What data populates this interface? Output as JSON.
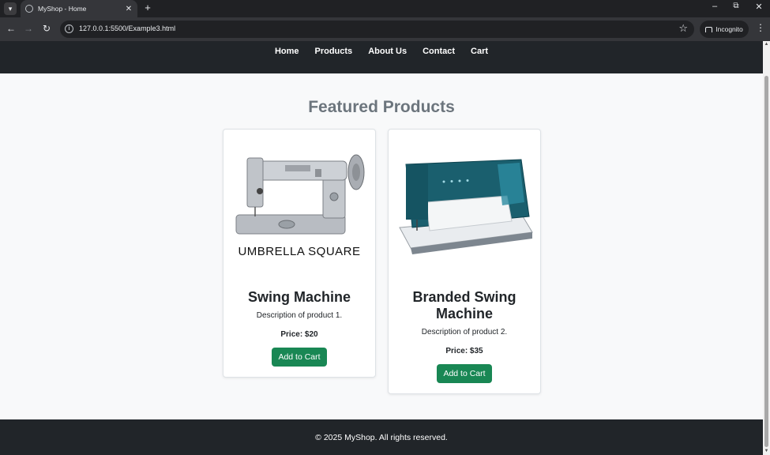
{
  "browser": {
    "tab_title": "MyShop - Home",
    "url": "127.0.0.1:5500/Example3.html",
    "incognito_label": "Incognito"
  },
  "nav": {
    "items": [
      "Home",
      "Products",
      "About Us",
      "Contact",
      "Cart"
    ]
  },
  "main": {
    "heading": "Featured Products",
    "products": [
      {
        "image_text": "UMBRELLA SQUARE",
        "name": "Swing Machine",
        "description": "Description of product 1.",
        "price": "Price: $20",
        "button": "Add to Cart"
      },
      {
        "image_text": "",
        "name": "Branded Swing Machine",
        "description": "Description of product 2.",
        "price": "Price: $35",
        "button": "Add to Cart"
      }
    ]
  },
  "footer": {
    "text": "© 2025 MyShop. All rights reserved."
  },
  "colors": {
    "nav_bg": "#212529",
    "page_bg": "#f8f9fa",
    "button_green": "#198754",
    "heading_gray": "#6c757d"
  }
}
